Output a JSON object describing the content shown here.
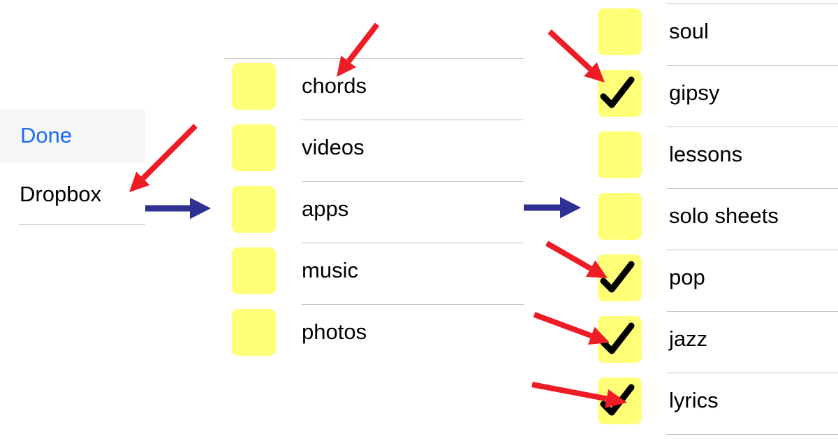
{
  "left_panel": {
    "done_label": "Done",
    "item_label": "Dropbox"
  },
  "middle_list": {
    "items": [
      {
        "label": "chords",
        "checked": false
      },
      {
        "label": "videos",
        "checked": false
      },
      {
        "label": "apps",
        "checked": false
      },
      {
        "label": "music",
        "checked": false
      },
      {
        "label": "photos",
        "checked": false
      }
    ]
  },
  "right_list": {
    "items": [
      {
        "label": "soul",
        "checked": false
      },
      {
        "label": "gipsy",
        "checked": true
      },
      {
        "label": "lessons",
        "checked": false
      },
      {
        "label": "solo sheets",
        "checked": false
      },
      {
        "label": "pop",
        "checked": true
      },
      {
        "label": "jazz",
        "checked": true
      },
      {
        "label": "lyrics",
        "checked": true
      }
    ]
  },
  "colors": {
    "accent": "#1a6cf5",
    "checkbox": "#ffff78",
    "annotation_red": "#ee1c25",
    "annotation_blue": "#2e3192"
  },
  "icons": {
    "checkmark": "checkmark-icon",
    "annotation": "arrow-icon"
  }
}
